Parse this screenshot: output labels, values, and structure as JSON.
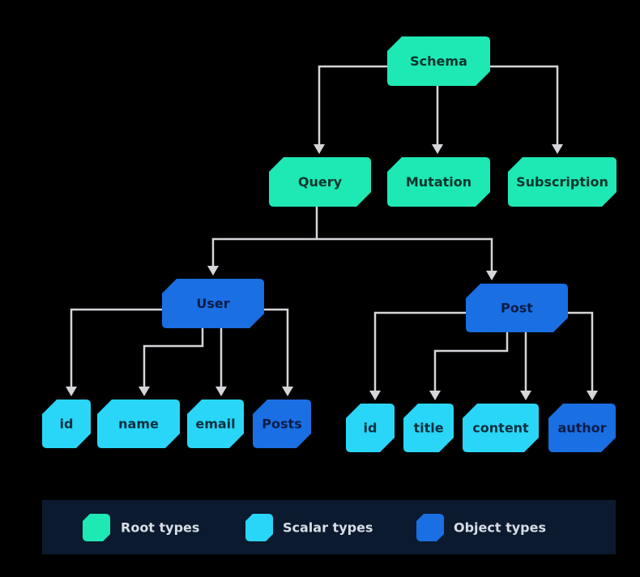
{
  "colors": {
    "root": "#1ee8b4",
    "scalar": "#2ad6f7",
    "object": "#1a6fe3",
    "root_text": "#08352c",
    "scalar_text": "#0a2f40",
    "object_text": "#0a1d45",
    "edge": "#d4d6da",
    "legend_bg": "#0b1a2e",
    "background": "#000000"
  },
  "nodes": {
    "schema": {
      "label": "Schema",
      "type": "root"
    },
    "query": {
      "label": "Query",
      "type": "root"
    },
    "mutation": {
      "label": "Mutation",
      "type": "root"
    },
    "subscription": {
      "label": "Subscription",
      "type": "root"
    },
    "user": {
      "label": "User",
      "type": "object"
    },
    "post": {
      "label": "Post",
      "type": "object"
    },
    "user_id": {
      "label": "id",
      "type": "scalar"
    },
    "user_name": {
      "label": "name",
      "type": "scalar"
    },
    "user_email": {
      "label": "email",
      "type": "scalar"
    },
    "user_posts": {
      "label": "Posts",
      "type": "object"
    },
    "post_id": {
      "label": "id",
      "type": "scalar"
    },
    "post_title": {
      "label": "title",
      "type": "scalar"
    },
    "post_content": {
      "label": "content",
      "type": "scalar"
    },
    "post_author": {
      "label": "author",
      "type": "object"
    }
  },
  "edges": [
    [
      "schema",
      "query"
    ],
    [
      "schema",
      "mutation"
    ],
    [
      "schema",
      "subscription"
    ],
    [
      "query",
      "user"
    ],
    [
      "query",
      "post"
    ],
    [
      "user",
      "user_id"
    ],
    [
      "user",
      "user_name"
    ],
    [
      "user",
      "user_email"
    ],
    [
      "user",
      "user_posts"
    ],
    [
      "post",
      "post_id"
    ],
    [
      "post",
      "post_title"
    ],
    [
      "post",
      "post_content"
    ],
    [
      "post",
      "post_author"
    ]
  ],
  "legend": [
    {
      "label": "Root types",
      "type": "root"
    },
    {
      "label": "Scalar types",
      "type": "scalar"
    },
    {
      "label": "Object types",
      "type": "object"
    }
  ]
}
